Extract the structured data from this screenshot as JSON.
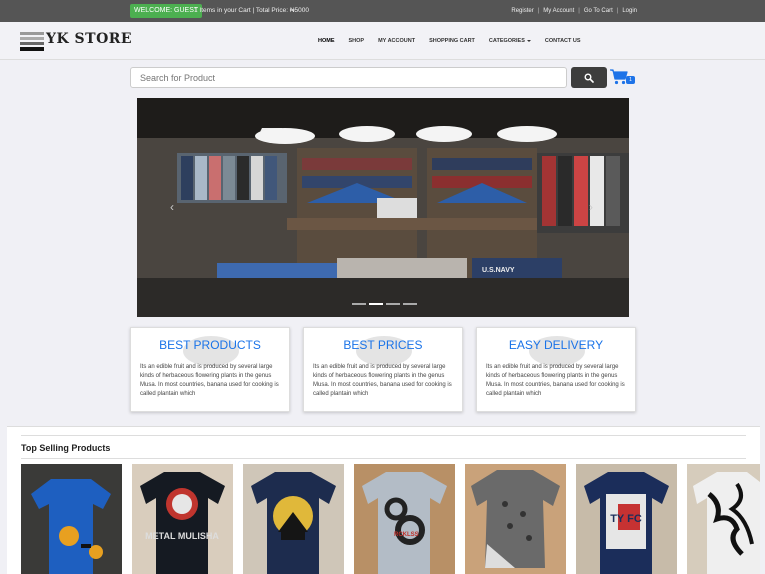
{
  "topbar": {
    "welcome": "WELCOME: GUEST",
    "cart_info": "1 Items in your Cart | Total Price: ₦5000",
    "links": [
      "Register",
      "My Account",
      "Go To Cart",
      "Login"
    ]
  },
  "navbar": {
    "brand": "YK STORE",
    "menu": [
      "HOME",
      "SHOP",
      "MY ACCOUNT",
      "SHOPPING CART",
      "CATEGORIES",
      "CONTACT US"
    ]
  },
  "search": {
    "placeholder": "Search for Product",
    "cart_count": "1"
  },
  "carousel": {
    "slide_text": "U.S.NAVY",
    "slides": 4,
    "active_slide": 1
  },
  "features": [
    {
      "title": "BEST PRODUCTS",
      "text": "Its an edible fruit and is produced by several large kinds of herbaceous flowering plants in the genus Musa. In most countries, banana used for cooking is called plantain which"
    },
    {
      "title": "BEST PRICES",
      "text": "Its an edible fruit and is produced by several large kinds of herbaceous flowering plants in the genus Musa. In most countries, banana used for cooking is called plantain which"
    },
    {
      "title": "EASY DELIVERY",
      "text": "Its an edible fruit and is produced by several large kinds of herbaceous flowering plants in the genus Musa. In most countries, banana used for cooking is called plantain which"
    }
  ],
  "top_selling": {
    "title": "Top Selling Products",
    "products": [
      {
        "name": "blue-tshirt"
      },
      {
        "name": "black-metal-tshirt",
        "print": "METAL MULISHA"
      },
      {
        "name": "navy-house-tshirt"
      },
      {
        "name": "grey-86-tshirt",
        "print": "RCKLSS"
      },
      {
        "name": "grey-pattern-tshirt"
      },
      {
        "name": "navy-fc-tshirt",
        "print": "TY FC"
      },
      {
        "name": "white-leaf-tshirt"
      }
    ]
  },
  "colors": {
    "topbar": "#555555",
    "welcome_green": "#4caf50",
    "accent_blue": "#1a73e8"
  }
}
